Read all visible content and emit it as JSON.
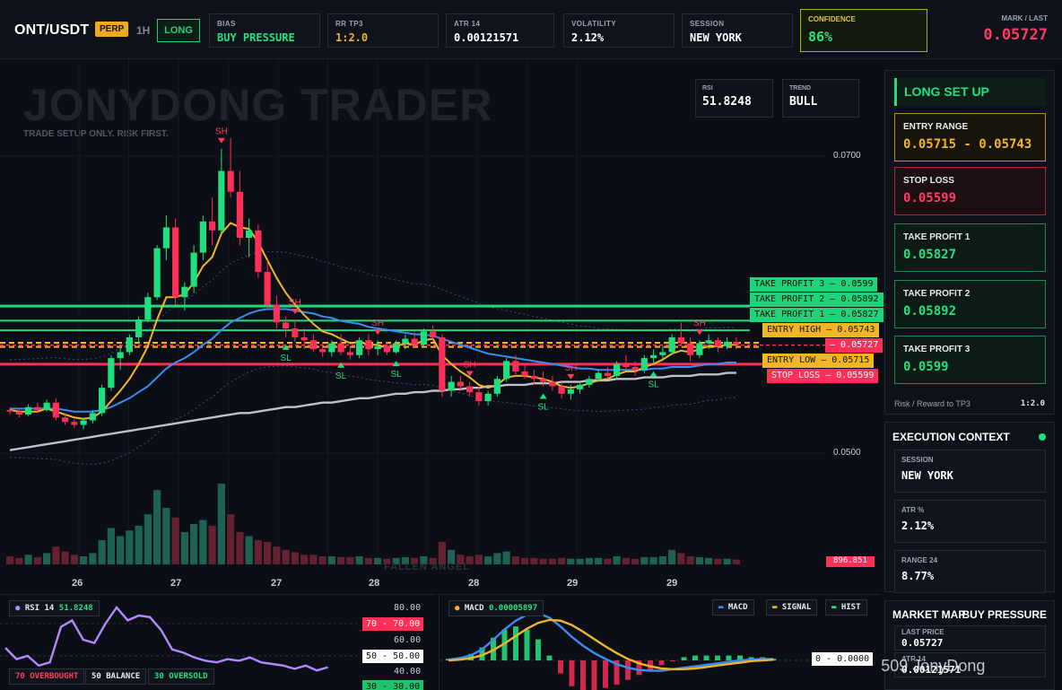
{
  "header": {
    "symbol": "ONT/USDT",
    "market_type": "PERP",
    "timeframe": "1H",
    "direction": "LONG",
    "stats": [
      {
        "key": "BIAS",
        "value": "BUY PRESSURE",
        "color": "#22e07f"
      },
      {
        "key": "RR TP3",
        "value": "1:2.0",
        "color": "#f1b626"
      },
      {
        "key": "ATR 14",
        "value": "0.00121571",
        "color": "#ffffff"
      },
      {
        "key": "VOLATILITY",
        "value": "2.12%",
        "color": "#ffffff"
      },
      {
        "key": "SESSION",
        "value": "NEW YORK",
        "color": "#ffffff"
      }
    ],
    "confidence_label": "CONFIDENCE",
    "confidence_value": "86%",
    "mark_label": "MARK / LAST",
    "mark_value": "0.05727"
  },
  "chart": {
    "watermark": "JONYDONG TRADER",
    "tagline": "TRADE SETUP ONLY. RISK FIRST.",
    "rsi_box": {
      "key": "RSI",
      "value": "51.8248"
    },
    "trend_box": {
      "key": "TREND",
      "value": "BULL"
    },
    "price_ticks": [
      "0.0700",
      "0.0500"
    ],
    "date_ticks": [
      "26",
      "27",
      "27",
      "28",
      "28",
      "29",
      "29"
    ],
    "level_labels": [
      {
        "text": "TAKE PROFIT 3",
        "value": "0.0599",
        "color": "#22e07f"
      },
      {
        "text": "TAKE PROFIT 2",
        "value": "0.05892",
        "color": "#22e07f"
      },
      {
        "text": "TAKE PROFIT 1",
        "value": "0.05827",
        "color": "#22e07f"
      },
      {
        "text": "ENTRY HIGH",
        "value": "0.05743",
        "color": "#f1b626"
      },
      {
        "text": "",
        "value": "0.05727",
        "color": "#ff2f57"
      },
      {
        "text": "ENTRY LOW",
        "value": "0.05715",
        "color": "#f1b626"
      },
      {
        "text": "STOP LOSS",
        "value": "0.05599",
        "color": "#ff2f57"
      }
    ],
    "swing_high_label": "SH",
    "swing_low_label": "SL",
    "footer_watermark": "FALLEN ANGEL",
    "volume_tag": "896.851"
  },
  "chart_data": {
    "type": "candlestick",
    "symbol": "ONT/USDT",
    "timeframe": "1H",
    "y_range": [
      0.045,
      0.075
    ],
    "x_ticks": [
      "26",
      "27",
      "27",
      "28",
      "28",
      "29",
      "29"
    ],
    "candles": [
      [
        0.0529,
        0.0531,
        0.0526,
        0.0528
      ],
      [
        0.0528,
        0.053,
        0.0524,
        0.0526
      ],
      [
        0.0526,
        0.0533,
        0.0525,
        0.0531
      ],
      [
        0.0531,
        0.0534,
        0.0527,
        0.0529
      ],
      [
        0.0529,
        0.0536,
        0.0528,
        0.0534
      ],
      [
        0.0534,
        0.0537,
        0.0522,
        0.0524
      ],
      [
        0.0524,
        0.0527,
        0.0519,
        0.0521
      ],
      [
        0.0521,
        0.0523,
        0.0517,
        0.0519
      ],
      [
        0.0519,
        0.0524,
        0.0516,
        0.0522
      ],
      [
        0.0522,
        0.0529,
        0.052,
        0.0527
      ],
      [
        0.0527,
        0.0546,
        0.0525,
        0.0544
      ],
      [
        0.0544,
        0.0566,
        0.0542,
        0.0564
      ],
      [
        0.0564,
        0.0572,
        0.0556,
        0.0568
      ],
      [
        0.0568,
        0.058,
        0.0566,
        0.0578
      ],
      [
        0.0578,
        0.0592,
        0.0574,
        0.059
      ],
      [
        0.059,
        0.0608,
        0.0588,
        0.0605
      ],
      [
        0.0605,
        0.064,
        0.0603,
        0.0638
      ],
      [
        0.0638,
        0.066,
        0.063,
        0.0652
      ],
      [
        0.0652,
        0.0658,
        0.06,
        0.0605
      ],
      [
        0.0605,
        0.0615,
        0.0596,
        0.0612
      ],
      [
        0.0612,
        0.064,
        0.0608,
        0.0635
      ],
      [
        0.0635,
        0.066,
        0.063,
        0.0656
      ],
      [
        0.0656,
        0.0672,
        0.064,
        0.065
      ],
      [
        0.065,
        0.0705,
        0.0648,
        0.069
      ],
      [
        0.069,
        0.0712,
        0.0672,
        0.0676
      ],
      [
        0.0676,
        0.069,
        0.064,
        0.0645
      ],
      [
        0.0645,
        0.0658,
        0.0632,
        0.065
      ],
      [
        0.065,
        0.0654,
        0.0618,
        0.0622
      ],
      [
        0.0622,
        0.063,
        0.0596,
        0.06
      ],
      [
        0.06,
        0.0606,
        0.0584,
        0.0588
      ],
      [
        0.0588,
        0.0592,
        0.0578,
        0.0584
      ],
      [
        0.0584,
        0.059,
        0.0575,
        0.0578
      ],
      [
        0.0578,
        0.0584,
        0.057,
        0.0576
      ],
      [
        0.0576,
        0.058,
        0.0568,
        0.057
      ],
      [
        0.057,
        0.0575,
        0.0565,
        0.0568
      ],
      [
        0.0568,
        0.0576,
        0.0565,
        0.0574
      ],
      [
        0.0574,
        0.058,
        0.0566,
        0.0568
      ],
      [
        0.0568,
        0.0572,
        0.0563,
        0.0566
      ],
      [
        0.0566,
        0.0578,
        0.0564,
        0.0576
      ],
      [
        0.0576,
        0.058,
        0.0566,
        0.057
      ],
      [
        0.057,
        0.0576,
        0.0566,
        0.0572
      ],
      [
        0.0572,
        0.0575,
        0.0566,
        0.0568
      ],
      [
        0.0568,
        0.0576,
        0.0567,
        0.0574
      ],
      [
        0.0574,
        0.058,
        0.057,
        0.0577
      ],
      [
        0.0577,
        0.0582,
        0.0571,
        0.0573
      ],
      [
        0.0573,
        0.0584,
        0.0572,
        0.0582
      ],
      [
        0.0582,
        0.0586,
        0.0575,
        0.0578
      ],
      [
        0.0578,
        0.058,
        0.0538,
        0.0542
      ],
      [
        0.0542,
        0.0552,
        0.0538,
        0.0548
      ],
      [
        0.0548,
        0.0552,
        0.0542,
        0.0545
      ],
      [
        0.0545,
        0.0548,
        0.0538,
        0.0541
      ],
      [
        0.0541,
        0.0545,
        0.0532,
        0.0535
      ],
      [
        0.0535,
        0.0542,
        0.0532,
        0.054
      ],
      [
        0.054,
        0.0552,
        0.0538,
        0.055
      ],
      [
        0.055,
        0.0564,
        0.0548,
        0.0562
      ],
      [
        0.0562,
        0.0566,
        0.0552,
        0.0555
      ],
      [
        0.0555,
        0.056,
        0.055,
        0.0552
      ],
      [
        0.0552,
        0.0556,
        0.0546,
        0.055
      ],
      [
        0.055,
        0.0555,
        0.0545,
        0.0548
      ],
      [
        0.0548,
        0.0552,
        0.0542,
        0.0545
      ],
      [
        0.0545,
        0.0548,
        0.0537,
        0.054
      ],
      [
        0.054,
        0.0546,
        0.0536,
        0.0543
      ],
      [
        0.0543,
        0.0548,
        0.054,
        0.0546
      ],
      [
        0.0546,
        0.0552,
        0.0544,
        0.055
      ],
      [
        0.055,
        0.0556,
        0.0548,
        0.0554
      ],
      [
        0.0554,
        0.0558,
        0.055,
        0.0552
      ],
      [
        0.0552,
        0.0562,
        0.055,
        0.056
      ],
      [
        0.056,
        0.0566,
        0.0556,
        0.0558
      ],
      [
        0.0558,
        0.0562,
        0.0552,
        0.0556
      ],
      [
        0.0556,
        0.0566,
        0.0554,
        0.0564
      ],
      [
        0.0564,
        0.057,
        0.056,
        0.0566
      ],
      [
        0.0566,
        0.0572,
        0.0562,
        0.0568
      ],
      [
        0.0568,
        0.058,
        0.0566,
        0.0578
      ],
      [
        0.0578,
        0.0588,
        0.0572,
        0.0574
      ],
      [
        0.0574,
        0.0578,
        0.0562,
        0.0566
      ],
      [
        0.0566,
        0.0576,
        0.0564,
        0.0574
      ],
      [
        0.0574,
        0.058,
        0.057,
        0.0576
      ],
      [
        0.0576,
        0.0578,
        0.0568,
        0.0572
      ],
      [
        0.0572,
        0.0578,
        0.057,
        0.0575
      ],
      [
        0.0575,
        0.0578,
        0.057,
        0.0573
      ]
    ],
    "volume": [
      0.1,
      0.08,
      0.12,
      0.09,
      0.14,
      0.22,
      0.16,
      0.12,
      0.1,
      0.14,
      0.3,
      0.45,
      0.35,
      0.42,
      0.48,
      0.62,
      0.92,
      0.7,
      0.58,
      0.4,
      0.5,
      0.55,
      0.48,
      1.0,
      0.62,
      0.4,
      0.35,
      0.3,
      0.28,
      0.22,
      0.18,
      0.15,
      0.12,
      0.12,
      0.1,
      0.1,
      0.09,
      0.09,
      0.1,
      0.08,
      0.08,
      0.07,
      0.08,
      0.09,
      0.08,
      0.1,
      0.08,
      0.28,
      0.18,
      0.12,
      0.1,
      0.12,
      0.1,
      0.14,
      0.16,
      0.1,
      0.08,
      0.08,
      0.07,
      0.07,
      0.08,
      0.07,
      0.07,
      0.08,
      0.08,
      0.07,
      0.1,
      0.08,
      0.07,
      0.09,
      0.09,
      0.1,
      0.18,
      0.14,
      0.1,
      0.09,
      0.08,
      0.07,
      0.07,
      0.06
    ],
    "ema_fast": [
      0.0529,
      0.0528,
      0.0528,
      0.0528,
      0.053,
      0.0528,
      0.0526,
      0.0524,
      0.0523,
      0.0524,
      0.0528,
      0.0535,
      0.0542,
      0.055,
      0.056,
      0.0572,
      0.059,
      0.0605,
      0.0605,
      0.0607,
      0.0615,
      0.0626,
      0.0632,
      0.0648,
      0.0655,
      0.0652,
      0.0651,
      0.0642,
      0.063,
      0.0618,
      0.0608,
      0.06,
      0.0593,
      0.0587,
      0.0582,
      0.058,
      0.0577,
      0.0574,
      0.0575,
      0.0573,
      0.0573,
      0.0571,
      0.0572,
      0.0574,
      0.0573,
      0.0576,
      0.0577,
      0.0566,
      0.056,
      0.0555,
      0.0551,
      0.0546,
      0.0544,
      0.0546,
      0.0551,
      0.0552,
      0.0552,
      0.0551,
      0.055,
      0.0548,
      0.0545,
      0.0544,
      0.0545,
      0.0547,
      0.0549,
      0.055,
      0.0553,
      0.0555,
      0.0555,
      0.0558,
      0.056,
      0.0563,
      0.0567,
      0.0569,
      0.0568,
      0.057,
      0.0572,
      0.0572,
      0.0573,
      0.0573
    ],
    "ema_slow": [
      0.053,
      0.053,
      0.053,
      0.053,
      0.053,
      0.053,
      0.0529,
      0.0528,
      0.0528,
      0.0528,
      0.0529,
      0.0531,
      0.0534,
      0.0537,
      0.0541,
      0.0545,
      0.0551,
      0.0557,
      0.0561,
      0.0564,
      0.0568,
      0.0573,
      0.0577,
      0.0583,
      0.0588,
      0.0591,
      0.0594,
      0.0596,
      0.0597,
      0.0597,
      0.0597,
      0.0596,
      0.0595,
      0.0594,
      0.0592,
      0.0591,
      0.0589,
      0.0588,
      0.0587,
      0.0585,
      0.0584,
      0.0583,
      0.0582,
      0.0581,
      0.058,
      0.058,
      0.0579,
      0.0577,
      0.0575,
      0.0573,
      0.0571,
      0.0569,
      0.0567,
      0.0566,
      0.0565,
      0.0564,
      0.0563,
      0.0562,
      0.0561,
      0.056,
      0.0559,
      0.0558,
      0.0557,
      0.0557,
      0.0556,
      0.0556,
      0.0556,
      0.0556,
      0.0556,
      0.0556,
      0.0557,
      0.0557,
      0.0558,
      0.0558,
      0.0558,
      0.0559,
      0.056,
      0.056,
      0.0561,
      0.0561
    ],
    "sma_long": [
      0.0502,
      0.0503,
      0.0504,
      0.0505,
      0.0506,
      0.0507,
      0.0508,
      0.0509,
      0.051,
      0.0511,
      0.0512,
      0.0513,
      0.0514,
      0.0515,
      0.0516,
      0.0517,
      0.0518,
      0.0519,
      0.052,
      0.0521,
      0.0522,
      0.0523,
      0.0524,
      0.0525,
      0.0526,
      0.0527,
      0.0527,
      0.0528,
      0.0529,
      0.053,
      0.0531,
      0.0531,
      0.0532,
      0.0533,
      0.0534,
      0.0534,
      0.0535,
      0.0536,
      0.0537,
      0.0537,
      0.0538,
      0.0539,
      0.054,
      0.054,
      0.0541,
      0.0541,
      0.0542,
      0.0542,
      0.0543,
      0.0543,
      0.0544,
      0.0544,
      0.0545,
      0.0545,
      0.0546,
      0.0546,
      0.0546,
      0.0547,
      0.0547,
      0.0547,
      0.0548,
      0.0548,
      0.0548,
      0.0549,
      0.0549,
      0.0549,
      0.055,
      0.055,
      0.055,
      0.0551,
      0.0551,
      0.0551,
      0.0552,
      0.0552,
      0.0552,
      0.0553,
      0.0553,
      0.0553,
      0.0554,
      0.0554
    ],
    "levels": {
      "tp3": 0.0599,
      "tp2": 0.05892,
      "tp1": 0.05827,
      "entry_high": 0.05743,
      "mark": 0.05727,
      "entry_low": 0.05715,
      "stop_loss": 0.05599
    },
    "swing_highs": [
      23,
      31,
      40,
      50,
      61,
      75,
      85
    ],
    "swing_lows": [
      30,
      36,
      42,
      58,
      70,
      86,
      91
    ]
  },
  "panel": {
    "title": "LONG SET UP",
    "cards": [
      {
        "key": "ENTRY RANGE",
        "value": "0.05715 - 0.05743",
        "color": "#f1b626",
        "border": "#c18a1b",
        "bg": "#17140c"
      },
      {
        "key": "STOP LOSS",
        "value": "0.05599",
        "color": "#ff3a63",
        "border": "#b2243f",
        "bg": "#1b0f14"
      },
      {
        "key": "TAKE PROFIT 1",
        "value": "0.05827",
        "color": "#22e07f",
        "border": "#1e8a52",
        "bg": "#0e1a15"
      },
      {
        "key": "TAKE PROFIT 2",
        "value": "0.05892",
        "color": "#22e07f",
        "border": "#1e8a52",
        "bg": "#0e1a15"
      },
      {
        "key": "TAKE PROFIT 3",
        "value": "0.0599",
        "color": "#22e07f",
        "border": "#1e8a52",
        "bg": "#0e1a15"
      }
    ],
    "rr_label": "Risk / Reward to TP3",
    "rr_value": "1:2.0"
  },
  "context": {
    "title": "EXECUTION CONTEXT",
    "cards": [
      {
        "key": "SESSION",
        "value": "NEW YORK"
      },
      {
        "key": "ATR %",
        "value": "2.12%"
      },
      {
        "key": "RANGE 24",
        "value": "8.77%"
      }
    ]
  },
  "market_map": {
    "title": "MARKET MAP",
    "state": "BUY PRESSURE",
    "cards": [
      {
        "key": "LAST PRICE",
        "value": "0.05727"
      },
      {
        "key": "ATR 14",
        "value": "0.00121571"
      }
    ]
  },
  "credit": "@509 JonyDong",
  "rsi_pane": {
    "label": "RSI 14",
    "value": "51.8248",
    "legend": [
      {
        "text": "70 OVERBOUGHT",
        "color": "#ff3a63"
      },
      {
        "text": "50 BALANCE",
        "color": "#e6e9ee"
      },
      {
        "text": "30 OVERSOLD",
        "color": "#22e07f"
      }
    ],
    "axis": [
      "80.00",
      "60.00",
      "40.00"
    ],
    "tags": [
      {
        "text": "70 - 70.00",
        "color": "#ff2f57",
        "fg": "#ffffff"
      },
      {
        "text": "50 - 50.00",
        "color": "#ffffff",
        "fg": "#111111"
      },
      {
        "text": "30 - 30.00",
        "color": "#1fc36b",
        "fg": "#0b0e14"
      }
    ],
    "values": [
      55,
      48,
      50,
      44,
      46,
      68,
      72,
      60,
      58,
      70,
      80,
      72,
      75,
      74,
      66,
      54,
      52,
      49,
      47,
      46,
      48,
      47,
      49,
      46,
      45,
      44,
      42,
      44,
      41,
      43
    ]
  },
  "macd_pane": {
    "label": "MACD",
    "value": "0.00005897",
    "legend": [
      {
        "text": "MACD",
        "color": "#3b8cf0"
      },
      {
        "text": "SIGNAL",
        "color": "#f1b626"
      },
      {
        "text": "HIST",
        "color": "#22e07f"
      }
    ],
    "zero_tag": "0 - 0.0000",
    "macd": [
      0.1,
      0.3,
      0.7,
      1.5,
      2.8,
      4.2,
      5.4,
      6.2,
      6.4,
      5.8,
      4.6,
      3.2,
      2.0,
      1.0,
      0.2,
      -0.5,
      -1.0,
      -1.3,
      -1.4,
      -1.4,
      -1.2,
      -1.0,
      -0.8,
      -0.6,
      -0.4,
      -0.2,
      0.0,
      0.1,
      0.2,
      0.2
    ],
    "signal": [
      0.0,
      0.1,
      0.3,
      0.7,
      1.4,
      2.3,
      3.3,
      4.3,
      5.1,
      5.5,
      5.4,
      4.8,
      3.9,
      2.9,
      1.9,
      1.0,
      0.2,
      -0.4,
      -0.8,
      -1.1,
      -1.2,
      -1.2,
      -1.1,
      -0.9,
      -0.7,
      -0.5,
      -0.3,
      -0.1,
      0.0,
      0.1
    ]
  }
}
